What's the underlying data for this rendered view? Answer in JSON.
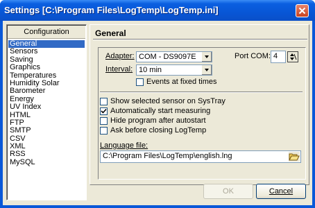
{
  "window": {
    "title": "Settings [C:\\Program Files\\LogTemp\\LogTemp.ini]"
  },
  "config": {
    "header": "Configuration",
    "items": [
      "General",
      "Sensors",
      "Saving",
      "Graphics",
      "Temperatures",
      "Humidity  Solar",
      "Barometer",
      "Energy",
      "UV Index",
      "HTML",
      "FTP",
      "SMTP",
      "CSV",
      "XML",
      "RSS",
      "MySQL"
    ],
    "selected": "General"
  },
  "general": {
    "title": "General",
    "adapter_label": "Adapter:",
    "adapter_value": "COM - DS9097E",
    "port_label": "Port COM:",
    "port_value": "4",
    "interval_label": "Interval:",
    "interval_value": "10 min",
    "events_label": "Events at fixed times",
    "options": [
      {
        "label": "Show selected sensor on SysTray",
        "checked": false
      },
      {
        "label": "Automatically start measuring",
        "checked": true
      },
      {
        "label": "Hide program after autostart",
        "checked": false
      },
      {
        "label": "Ask before closing LogTemp",
        "checked": false
      }
    ],
    "language_label": "Language file:",
    "language_value": "C:\\Program Files\\LogTemp\\english.lng"
  },
  "buttons": {
    "ok": "OK",
    "cancel": "Cancel"
  }
}
